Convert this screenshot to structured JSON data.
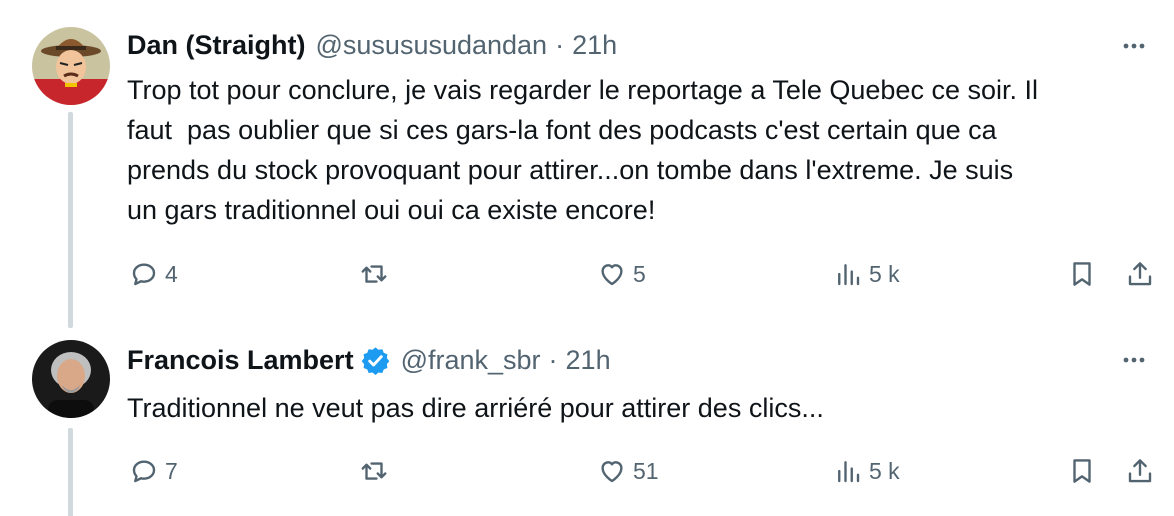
{
  "tweets": [
    {
      "display_name": "Dan (Straight)",
      "handle": "@susususudandan",
      "separator": "·",
      "time": "21h",
      "verified": false,
      "text": "Trop tot pour conclure, je vais regarder le reportage a Tele Quebec ce soir. Il\nfaut  pas oublier que si ces gars-la font des podcasts c'est certain que ca\nprends du stock provoquant pour attirer...on tombe dans l'extreme. Je suis\nun gars traditionnel oui oui ca existe encore!",
      "replies": "4",
      "retweets": "",
      "likes": "5",
      "views": "5 k"
    },
    {
      "display_name": "Francois Lambert",
      "handle": "@frank_sbr",
      "separator": "·",
      "time": "21h",
      "verified": true,
      "text": "Traditionnel ne veut pas dire arriéré pour attirer des clics...",
      "replies": "7",
      "retweets": "",
      "likes": "51",
      "views": "5 k"
    }
  ],
  "colors": {
    "text_primary": "#0f1419",
    "text_secondary": "#536471",
    "thread_line": "#cfd9de",
    "verified_blue": "#1d9bf0"
  },
  "icons": {
    "reply": "reply-icon",
    "retweet": "retweet-icon",
    "like": "heart-icon",
    "views": "views-icon",
    "bookmark": "bookmark-icon",
    "share": "share-icon",
    "more": "more-icon",
    "verified": "verified-badge-icon"
  }
}
